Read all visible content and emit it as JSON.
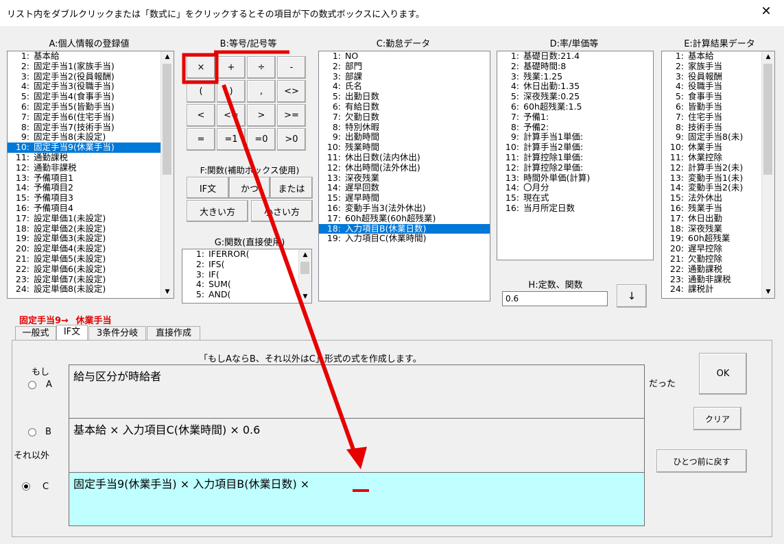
{
  "window": {
    "title": "リスト内をダブルクリックまたは「数式に」をクリックするとその項目が下の数式ボックスに入ります。",
    "close": "✕"
  },
  "panelA": {
    "label": "A:個人情報の登録値",
    "items": [
      {
        "n": "1:",
        "t": "基本給"
      },
      {
        "n": "2:",
        "t": "固定手当1(家族手当)"
      },
      {
        "n": "3:",
        "t": "固定手当2(役員報酬)"
      },
      {
        "n": "4:",
        "t": "固定手当3(役職手当)"
      },
      {
        "n": "5:",
        "t": "固定手当4(食事手当)"
      },
      {
        "n": "6:",
        "t": "固定手当5(皆勤手当)"
      },
      {
        "n": "7:",
        "t": "固定手当6(住宅手当)"
      },
      {
        "n": "8:",
        "t": "固定手当7(技術手当)"
      },
      {
        "n": "9:",
        "t": "固定手当8(未設定)"
      },
      {
        "n": "10:",
        "t": "固定手当9(休業手当)"
      },
      {
        "n": "11:",
        "t": "通勤課税"
      },
      {
        "n": "12:",
        "t": "通勤非課税"
      },
      {
        "n": "13:",
        "t": "予備項目1"
      },
      {
        "n": "14:",
        "t": "予備項目2"
      },
      {
        "n": "15:",
        "t": "予備項目3"
      },
      {
        "n": "16:",
        "t": "予備項目4"
      },
      {
        "n": "17:",
        "t": "設定単価1(未設定)"
      },
      {
        "n": "18:",
        "t": "設定単価2(未設定)"
      },
      {
        "n": "19:",
        "t": "設定単価3(未設定)"
      },
      {
        "n": "20:",
        "t": "設定単価4(未設定)"
      },
      {
        "n": "21:",
        "t": "設定単価5(未設定)"
      },
      {
        "n": "22:",
        "t": "設定単価6(未設定)"
      },
      {
        "n": "23:",
        "t": "設定単価7(未設定)"
      },
      {
        "n": "24:",
        "t": "設定単価8(未設定)"
      }
    ]
  },
  "panelB": {
    "label": "B:等号/記号等",
    "buttons": [
      "×",
      "+",
      "÷",
      "-",
      "(",
      ")",
      ",",
      "<>",
      "<",
      "<=",
      ">",
      ">=",
      "=",
      "=1",
      "=0",
      ">0"
    ]
  },
  "panelF": {
    "label": "F:関数(補助ボックス使用)",
    "buttons": [
      "IF文",
      "かつ",
      "または",
      "大きい方",
      "小さい方"
    ]
  },
  "panelG": {
    "label": "G:関数(直接使用)",
    "items": [
      {
        "n": "1:",
        "t": "IFERROR("
      },
      {
        "n": "2:",
        "t": "IFS("
      },
      {
        "n": "3:",
        "t": "IF("
      },
      {
        "n": "4:",
        "t": "SUM("
      },
      {
        "n": "5:",
        "t": "AND("
      }
    ]
  },
  "panelC": {
    "label": "C:勤怠データ",
    "items": [
      {
        "n": "1:",
        "t": "NO"
      },
      {
        "n": "2:",
        "t": "部門"
      },
      {
        "n": "3:",
        "t": "部課"
      },
      {
        "n": "4:",
        "t": "氏名"
      },
      {
        "n": "5:",
        "t": "出勤日数"
      },
      {
        "n": "6:",
        "t": "有給日数"
      },
      {
        "n": "7:",
        "t": "欠勤日数"
      },
      {
        "n": "8:",
        "t": "特別休暇"
      },
      {
        "n": "9:",
        "t": "出勤時間"
      },
      {
        "n": "10:",
        "t": "残業時間"
      },
      {
        "n": "11:",
        "t": "休出日数(法内休出)"
      },
      {
        "n": "12:",
        "t": "休出時間(法外休出)"
      },
      {
        "n": "13:",
        "t": "深夜残業"
      },
      {
        "n": "14:",
        "t": "遅早回数"
      },
      {
        "n": "15:",
        "t": "遅早時間"
      },
      {
        "n": "16:",
        "t": "変動手当3(法外休出)"
      },
      {
        "n": "17:",
        "t": "60h超残業(60h超残業)"
      },
      {
        "n": "18:",
        "t": "入力項目B(休業日数)"
      },
      {
        "n": "19:",
        "t": "入力項目C(休業時間)"
      }
    ]
  },
  "panelD": {
    "label": "D:率/単価等",
    "items": [
      {
        "n": "1:",
        "t": "基礎日数:21.4"
      },
      {
        "n": "2:",
        "t": "基礎時間:8"
      },
      {
        "n": "3:",
        "t": "残業:1.25"
      },
      {
        "n": "4:",
        "t": "休日出勤:1.35"
      },
      {
        "n": "5:",
        "t": "深夜残業:0.25"
      },
      {
        "n": "6:",
        "t": "60h超残業:1.5"
      },
      {
        "n": "7:",
        "t": "予備1:"
      },
      {
        "n": "8:",
        "t": "予備2:"
      },
      {
        "n": "9:",
        "t": "計算手当1単価:"
      },
      {
        "n": "10:",
        "t": "計算手当2単価:"
      },
      {
        "n": "11:",
        "t": "計算控除1単価:"
      },
      {
        "n": "12:",
        "t": "計算控除2単価:"
      },
      {
        "n": "13:",
        "t": "時間外単価(計算)"
      },
      {
        "n": "14:",
        "t": "〇月分"
      },
      {
        "n": "15:",
        "t": "現在式"
      },
      {
        "n": "16:",
        "t": "当月所定日数"
      }
    ]
  },
  "panelH": {
    "label": "H:定数、関数",
    "value": "0.6",
    "button": "↓"
  },
  "panelE": {
    "label": "E:計算結果データ",
    "items": [
      {
        "n": "1:",
        "t": "基本給"
      },
      {
        "n": "2:",
        "t": "家族手当"
      },
      {
        "n": "3:",
        "t": "役員報酬"
      },
      {
        "n": "4:",
        "t": "役職手当"
      },
      {
        "n": "5:",
        "t": "食事手当"
      },
      {
        "n": "6:",
        "t": "皆勤手当"
      },
      {
        "n": "7:",
        "t": "住宅手当"
      },
      {
        "n": "8:",
        "t": "技術手当"
      },
      {
        "n": "9:",
        "t": "固定手当8(未)"
      },
      {
        "n": "10:",
        "t": "休業手当"
      },
      {
        "n": "11:",
        "t": "休業控除"
      },
      {
        "n": "12:",
        "t": "計算手当2(未)"
      },
      {
        "n": "13:",
        "t": "変動手当1(未)"
      },
      {
        "n": "14:",
        "t": "変動手当2(未)"
      },
      {
        "n": "15:",
        "t": "法外休出"
      },
      {
        "n": "16:",
        "t": "残業手当"
      },
      {
        "n": "17:",
        "t": "休日出勤"
      },
      {
        "n": "18:",
        "t": "深夜残業"
      },
      {
        "n": "19:",
        "t": "60h超残業"
      },
      {
        "n": "20:",
        "t": "遅早控除"
      },
      {
        "n": "21:",
        "t": "欠勤控除"
      },
      {
        "n": "22:",
        "t": "通勤課税"
      },
      {
        "n": "23:",
        "t": "通勤非課税"
      },
      {
        "n": "24:",
        "t": "課税計"
      }
    ]
  },
  "target": {
    "name": "固定手当9→",
    "value": "休業手当"
  },
  "tabs": [
    "一般式",
    "IF文",
    "3条件分岐",
    "直接作成"
  ],
  "ifPanel": {
    "description": "「もしAならB、それ以外はC」形式の式を作成します。",
    "if_label": "もし",
    "else_label": "それ以外",
    "then_label": "だった",
    "radioA": "A",
    "radioB": "B",
    "radioC": "C",
    "exprA": "給与区分が時給者",
    "exprB": "基本給 × 入力項目C(休業時間) × 0.6",
    "exprC": "固定手当9(休業手当) × 入力項目B(休業日数) ×",
    "ok": "OK",
    "clear": "クリア",
    "undo": "ひとつ前に戻す"
  },
  "colors": {
    "selection": "#0078d7",
    "annotation": "#e60000",
    "activeBox": "#bfffff",
    "targetText": "#e00000"
  }
}
